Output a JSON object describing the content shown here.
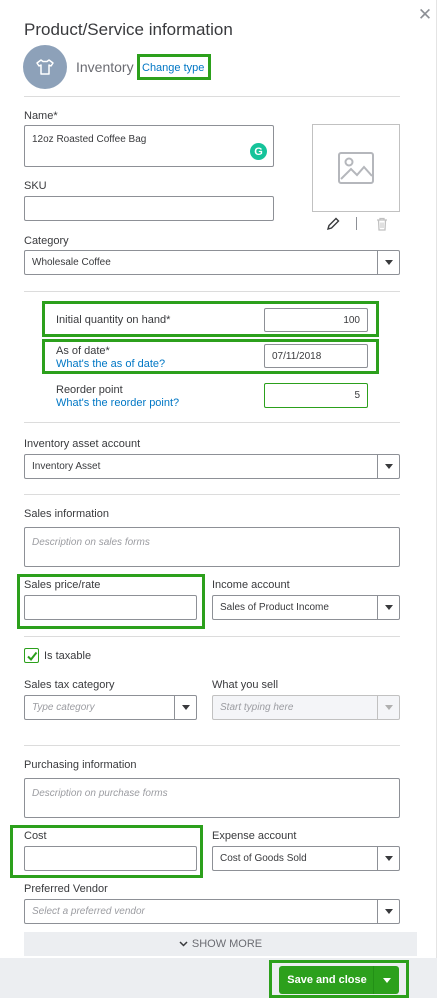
{
  "panel": {
    "title": "Product/Service information",
    "type_label": "Inventory",
    "change_type": "Change type",
    "close_icon": "close-icon"
  },
  "fields": {
    "name_label": "Name*",
    "name_value": "12oz Roasted Coffee Bag",
    "sku_label": "SKU",
    "sku_value": "",
    "category_label": "Category",
    "category_value": "Wholesale Coffee",
    "initial_qty_label": "Initial quantity on hand*",
    "initial_qty_value": "100",
    "as_of_label": "As of date*",
    "as_of_link": "What's the as of date?",
    "as_of_value": "07/11/2018",
    "reorder_label": "Reorder point",
    "reorder_link": "What's the reorder point?",
    "reorder_value": "5",
    "asset_account_label": "Inventory asset account",
    "asset_account_value": "Inventory Asset"
  },
  "sales": {
    "heading": "Sales information",
    "description_placeholder": "Description on sales forms",
    "price_label": "Sales price/rate",
    "price_value": "",
    "income_label": "Income account",
    "income_value": "Sales of Product Income",
    "taxable_label": "Is taxable",
    "taxable_checked": true,
    "tax_category_label": "Sales tax category",
    "tax_category_placeholder": "Type category",
    "what_you_sell_label": "What you sell",
    "what_you_sell_placeholder": "Start typing here"
  },
  "purchasing": {
    "heading": "Purchasing information",
    "description_placeholder": "Description on purchase forms",
    "cost_label": "Cost",
    "cost_value": "",
    "expense_label": "Expense account",
    "expense_value": "Cost of Goods Sold",
    "vendor_label": "Preferred Vendor",
    "vendor_placeholder": "Select a preferred vendor"
  },
  "footer": {
    "show_more": "SHOW MORE",
    "save_close": "Save and close"
  },
  "colors": {
    "accent": "#2ca01c",
    "link": "#0077c5",
    "avatar": "#8da1b9"
  }
}
